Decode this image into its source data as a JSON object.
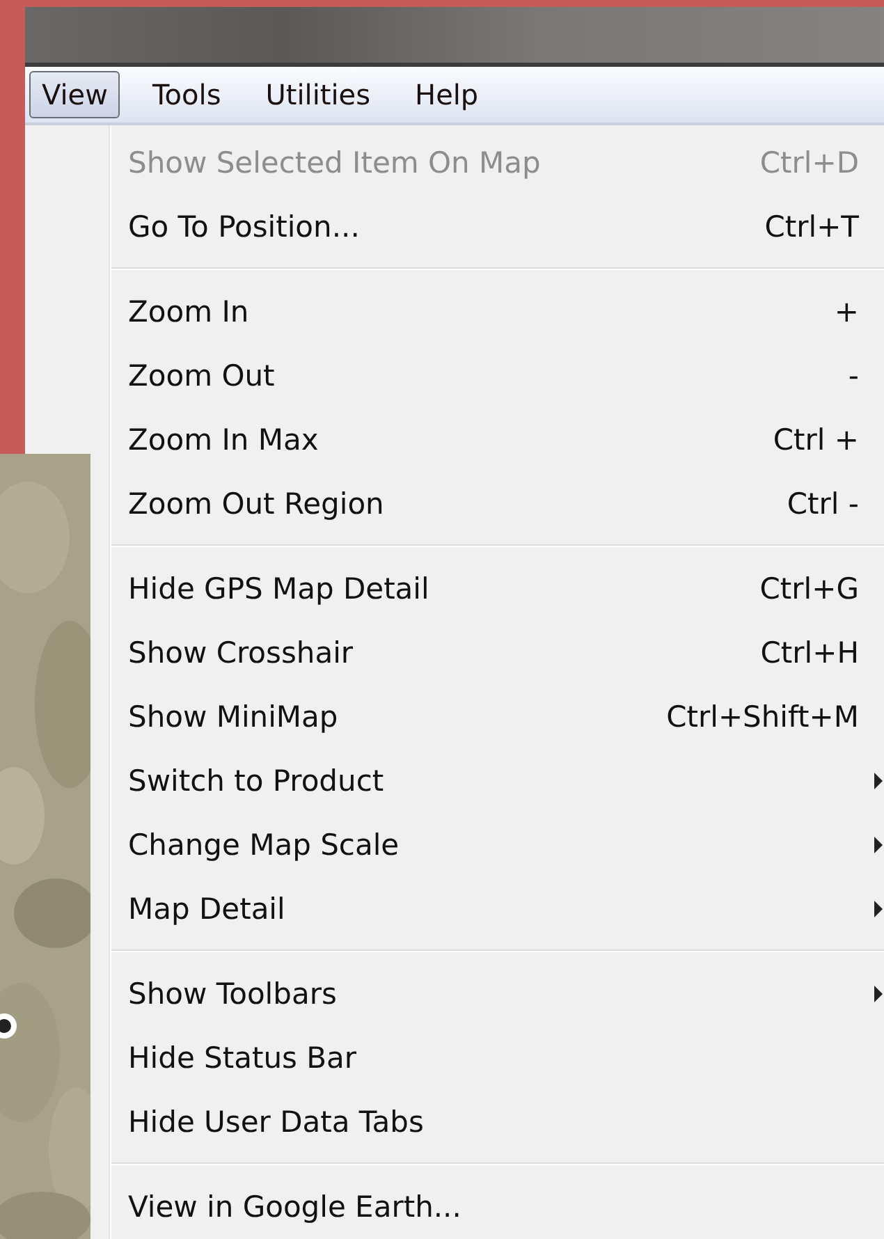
{
  "menubar": [
    {
      "label": "View",
      "selected": true
    },
    {
      "label": "Tools",
      "selected": false
    },
    {
      "label": "Utilities",
      "selected": false
    },
    {
      "label": "Help",
      "selected": false
    }
  ],
  "menu": {
    "sections": [
      [
        {
          "label": "Show Selected Item On Map",
          "shortcut": "Ctrl+D",
          "disabled": true,
          "has_submenu": false
        },
        {
          "label": "Go To Position...",
          "shortcut": "Ctrl+T",
          "disabled": false,
          "has_submenu": false
        }
      ],
      [
        {
          "label": "Zoom In",
          "shortcut": "+",
          "disabled": false,
          "has_submenu": false
        },
        {
          "label": "Zoom Out",
          "shortcut": "-",
          "disabled": false,
          "has_submenu": false
        },
        {
          "label": "Zoom In Max",
          "shortcut": "Ctrl +",
          "disabled": false,
          "has_submenu": false
        },
        {
          "label": "Zoom Out Region",
          "shortcut": "Ctrl -",
          "disabled": false,
          "has_submenu": false
        }
      ],
      [
        {
          "label": "Hide GPS Map Detail",
          "shortcut": "Ctrl+G",
          "disabled": false,
          "has_submenu": false
        },
        {
          "label": "Show Crosshair",
          "shortcut": "Ctrl+H",
          "disabled": false,
          "has_submenu": false
        },
        {
          "label": "Show MiniMap",
          "shortcut": "Ctrl+Shift+M",
          "disabled": false,
          "has_submenu": false
        },
        {
          "label": "Switch to Product",
          "disabled": false,
          "has_submenu": true
        },
        {
          "label": "Change Map Scale",
          "disabled": false,
          "has_submenu": true
        },
        {
          "label": "Map Detail",
          "disabled": false,
          "has_submenu": true
        }
      ],
      [
        {
          "label": "Show Toolbars",
          "disabled": false,
          "has_submenu": true
        },
        {
          "label": "Hide Status Bar",
          "disabled": false,
          "has_submenu": false
        },
        {
          "label": "Hide User Data Tabs",
          "disabled": false,
          "has_submenu": false
        }
      ],
      [
        {
          "label": "View in Google Earth...",
          "disabled": false,
          "has_submenu": false
        }
      ]
    ]
  }
}
